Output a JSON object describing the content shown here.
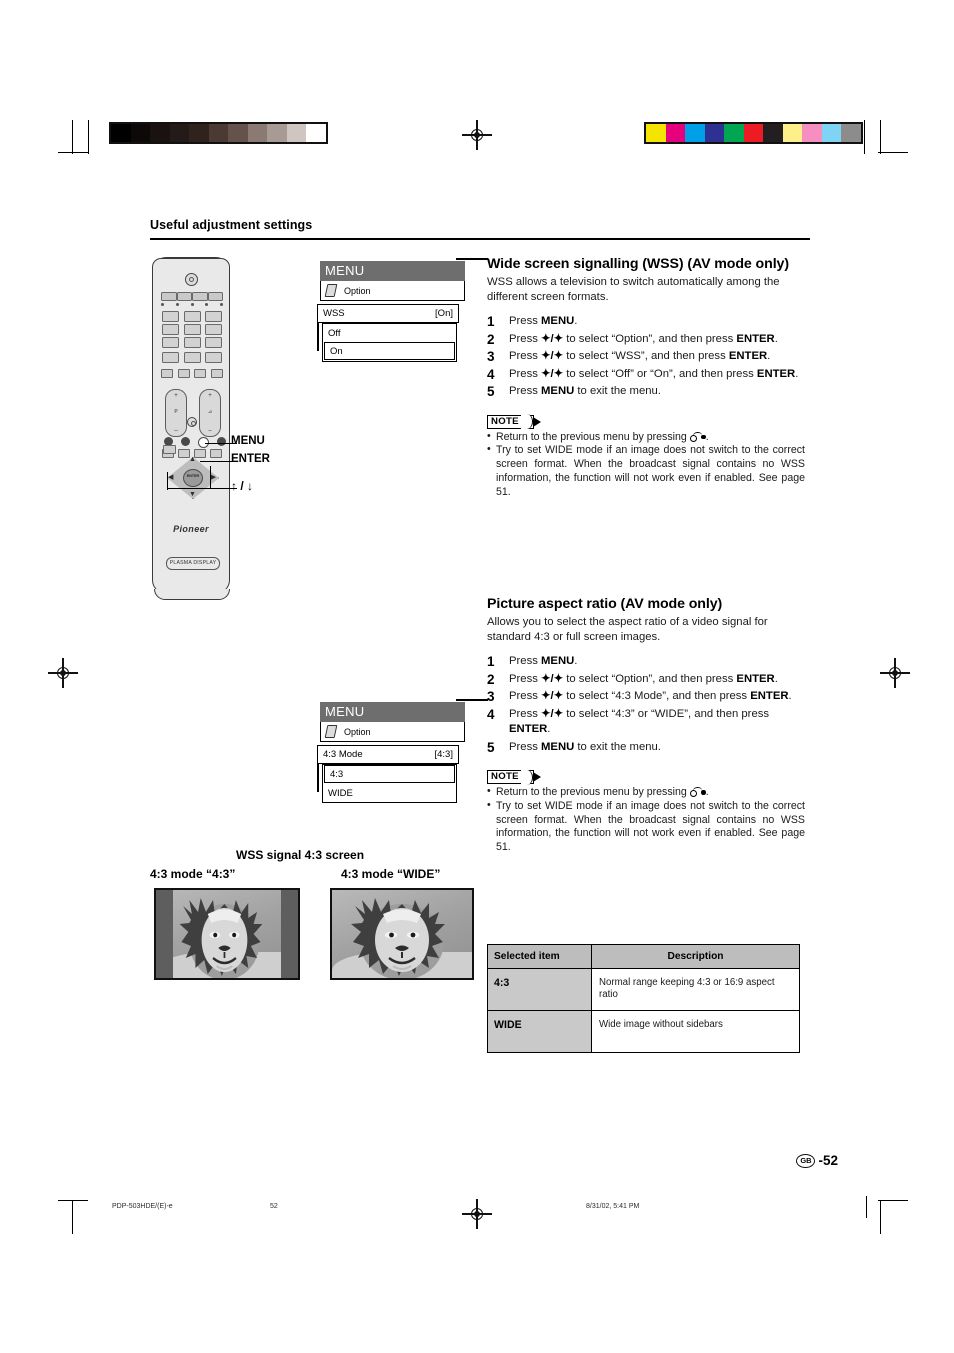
{
  "page": {
    "section_title": "Useful adjustment settings",
    "page_number": "52",
    "locale_badge": "GB",
    "page_separator": "-"
  },
  "remote": {
    "brand": "Pioneer",
    "model_label": "PLASMA DISPLAY",
    "enter_key_label": "ENTER",
    "callouts": [
      {
        "label": "MENU"
      },
      {
        "label": "ENTER"
      },
      {
        "label": "↑ / ↓"
      }
    ]
  },
  "osd_wss": {
    "title": "MENU",
    "option_label": "Option",
    "row_label": "WSS",
    "row_value": "[On]",
    "items": [
      {
        "label": "Off",
        "selected": false
      },
      {
        "label": "On",
        "selected": true
      }
    ]
  },
  "osd_aspect": {
    "title": "MENU",
    "option_label": "Option",
    "row_label": "4:3 Mode",
    "row_value": "[4:3]",
    "items": [
      {
        "label": "4:3",
        "selected": true
      },
      {
        "label": "WIDE",
        "selected": false
      }
    ]
  },
  "figure": {
    "caption": "WSS signal 4:3 screen",
    "left_label": "4:3 mode “4:3”",
    "right_label": "4:3 mode “WIDE”"
  },
  "wss_section": {
    "heading": "Wide screen signalling (WSS) (AV mode only)",
    "intro": "WSS allows a television to switch automatically among the different screen formats.",
    "steps": [
      {
        "n": "1",
        "text": "Press MENU."
      },
      {
        "n": "2",
        "text": "Press ↑/↓ to select “Option”, and then press ENTER."
      },
      {
        "n": "3",
        "text": "Press ↑/↓ to select “WSS”, and then press ENTER."
      },
      {
        "n": "4",
        "text": "Press ↑/↓ to select “Off” or “On”, and then press ENTER."
      },
      {
        "n": "5",
        "text": "Press MENU to exit the menu."
      }
    ],
    "note_label": "NOTE",
    "notes": [
      "Return to the previous menu by pressing .",
      "Try to set WIDE mode if an image does not switch to the correct screen format. When the broadcast signal contains no WSS information, the function will not work even if enabled. See page 51."
    ]
  },
  "aspect_section": {
    "heading": "Picture aspect ratio (AV mode only)",
    "intro": "Allows you to select the aspect ratio of a video signal for standard 4:3 or full screen images.",
    "steps": [
      {
        "n": "1",
        "text": "Press MENU."
      },
      {
        "n": "2",
        "text": "Press ↑/↓ to select “Option”, and then press ENTER."
      },
      {
        "n": "3",
        "text": "Press ↑/↓ to select “4:3 Mode”, and then press ENTER."
      },
      {
        "n": "4",
        "text": "Press ↑/↓ to select “4:3” or “WIDE”, and then press ENTER."
      },
      {
        "n": "5",
        "text": "Press MENU to exit the menu."
      }
    ],
    "note_label": "NOTE",
    "notes": [
      "Return to the previous menu by pressing .",
      "Try to set WIDE mode if an image does not switch to the correct screen format. When the broadcast signal contains no WSS information, the function will not work even if enabled. See page 51."
    ]
  },
  "table": {
    "headers": [
      "Selected item",
      "Description"
    ],
    "rows": [
      {
        "item": "4:3",
        "description": "Normal range keeping 4:3 or 16:9 aspect ratio"
      },
      {
        "item": "WIDE",
        "description": "Wide image without sidebars"
      }
    ]
  },
  "printer_marks": {
    "file_name": "PDP-503HDE/(E)-e",
    "sheet_number": "52",
    "timestamp": "8/31/02, 5:41 PM",
    "grayscale_bar": [
      "#000000",
      "#0d0908",
      "#191210",
      "#241a17",
      "#30231e",
      "#4b3a34",
      "#65524b",
      "#8b7a74",
      "#a89b96",
      "#cfc6c2",
      "#ffffff"
    ],
    "color_bar": [
      "#f5e400",
      "#e6007e",
      "#00a0e9",
      "#2e3192",
      "#00a651",
      "#ed1c24",
      "#231f20",
      "#fdf08a",
      "#f58fc2",
      "#7fd4f5",
      "#8c8c8c"
    ]
  }
}
